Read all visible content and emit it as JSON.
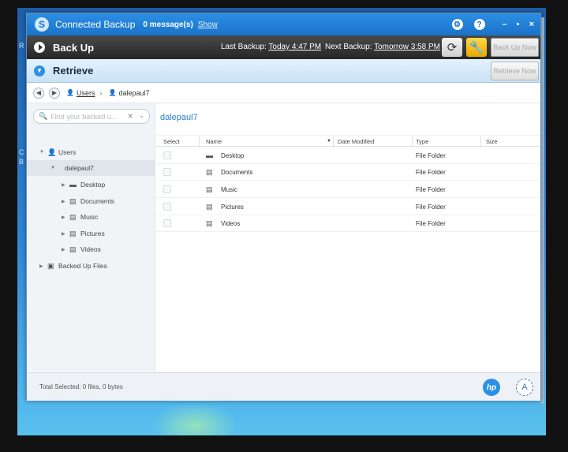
{
  "titlebar": {
    "app_title": "Connected Backup",
    "messages": "0 message(s)",
    "show_link": "Show",
    "icons": [
      "gear-icon",
      "help-icon"
    ],
    "minimize": "–",
    "maximize": "▪",
    "close": "×"
  },
  "backup": {
    "title": "Back Up",
    "last_backup_label": "Last Backup:",
    "last_backup_value": "Today 4:47 PM",
    "next_backup_label": "Next Backup:",
    "next_backup_value": "Tomorrow 3:58 PM",
    "button": "Back Up Now"
  },
  "retrieve": {
    "title": "Retrieve",
    "button": "Retrieve Now"
  },
  "breadcrumb": {
    "items": [
      "Users",
      "dalepaul7"
    ]
  },
  "search": {
    "placeholder": "Find your backed u..."
  },
  "tree": [
    {
      "label": "Users",
      "level": 0,
      "expanded": true
    },
    {
      "label": "dalepaul7",
      "level": 1,
      "expanded": true,
      "selected": true
    },
    {
      "label": "Desktop",
      "level": 2
    },
    {
      "label": "Documents",
      "level": 2
    },
    {
      "label": "Music",
      "level": 2
    },
    {
      "label": "Pictures",
      "level": 2
    },
    {
      "label": "Videos",
      "level": 2
    },
    {
      "label": "Backed Up Files",
      "level": 0
    }
  ],
  "main": {
    "folder_title": "dalepaul7",
    "columns": [
      "Select",
      "Name",
      "Date Modified",
      "Type",
      "Size"
    ],
    "rows": [
      {
        "name": "Desktop",
        "type": "File Folder"
      },
      {
        "name": "Documents",
        "type": "File Folder"
      },
      {
        "name": "Music",
        "type": "File Folder"
      },
      {
        "name": "Pictures",
        "type": "File Folder"
      },
      {
        "name": "Videos",
        "type": "File Folder"
      }
    ]
  },
  "footer": {
    "total": "Total Selected: 0 files, 0 bytes",
    "hp_logo": "hp",
    "autonomy_logo": "A"
  },
  "desktop_strip": [
    "R",
    "C",
    "B"
  ]
}
